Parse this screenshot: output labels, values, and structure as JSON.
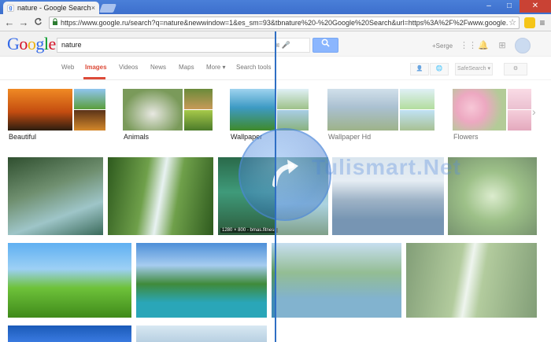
{
  "browser": {
    "tab_title": "nature - Google Search",
    "tab_close": "×",
    "url": "https://www.google.ru/search?q=nature&newwindow=1&es_sm=93&tbnature%20-%20Google%20Search&url=https%3A%2F%2Fwww.google.ru%2f",
    "window_controls": {
      "minimize": "–",
      "maximize": "□",
      "close": "✕"
    },
    "nav": {
      "back": "←",
      "forward": "→",
      "reload": "C"
    },
    "menu": "≡"
  },
  "google": {
    "logo": "Google",
    "search_query": "nature",
    "search_button": "🔍",
    "plus_user": "+Serge",
    "nav_tabs": [
      "Web",
      "Images",
      "Videos",
      "News",
      "Maps",
      "More ▾",
      "Search tools"
    ],
    "active_tab": "Images",
    "safesearch": "SafeSearch ▾",
    "settings": "⚙"
  },
  "related": [
    {
      "label": "Beautiful"
    },
    {
      "label": "Animals"
    },
    {
      "label": "Wallpaper"
    },
    {
      "label": "Wallpaper Hd"
    },
    {
      "label": "Flowers"
    }
  ],
  "overlay": {
    "watermark": "Tulismart.Net",
    "caption": "1280 × 800 - bmas.fitness"
  },
  "colors": {
    "accent_red": "#dd4b39",
    "search_blue": "#4d90fe",
    "split_line": "#2f6fc4"
  }
}
